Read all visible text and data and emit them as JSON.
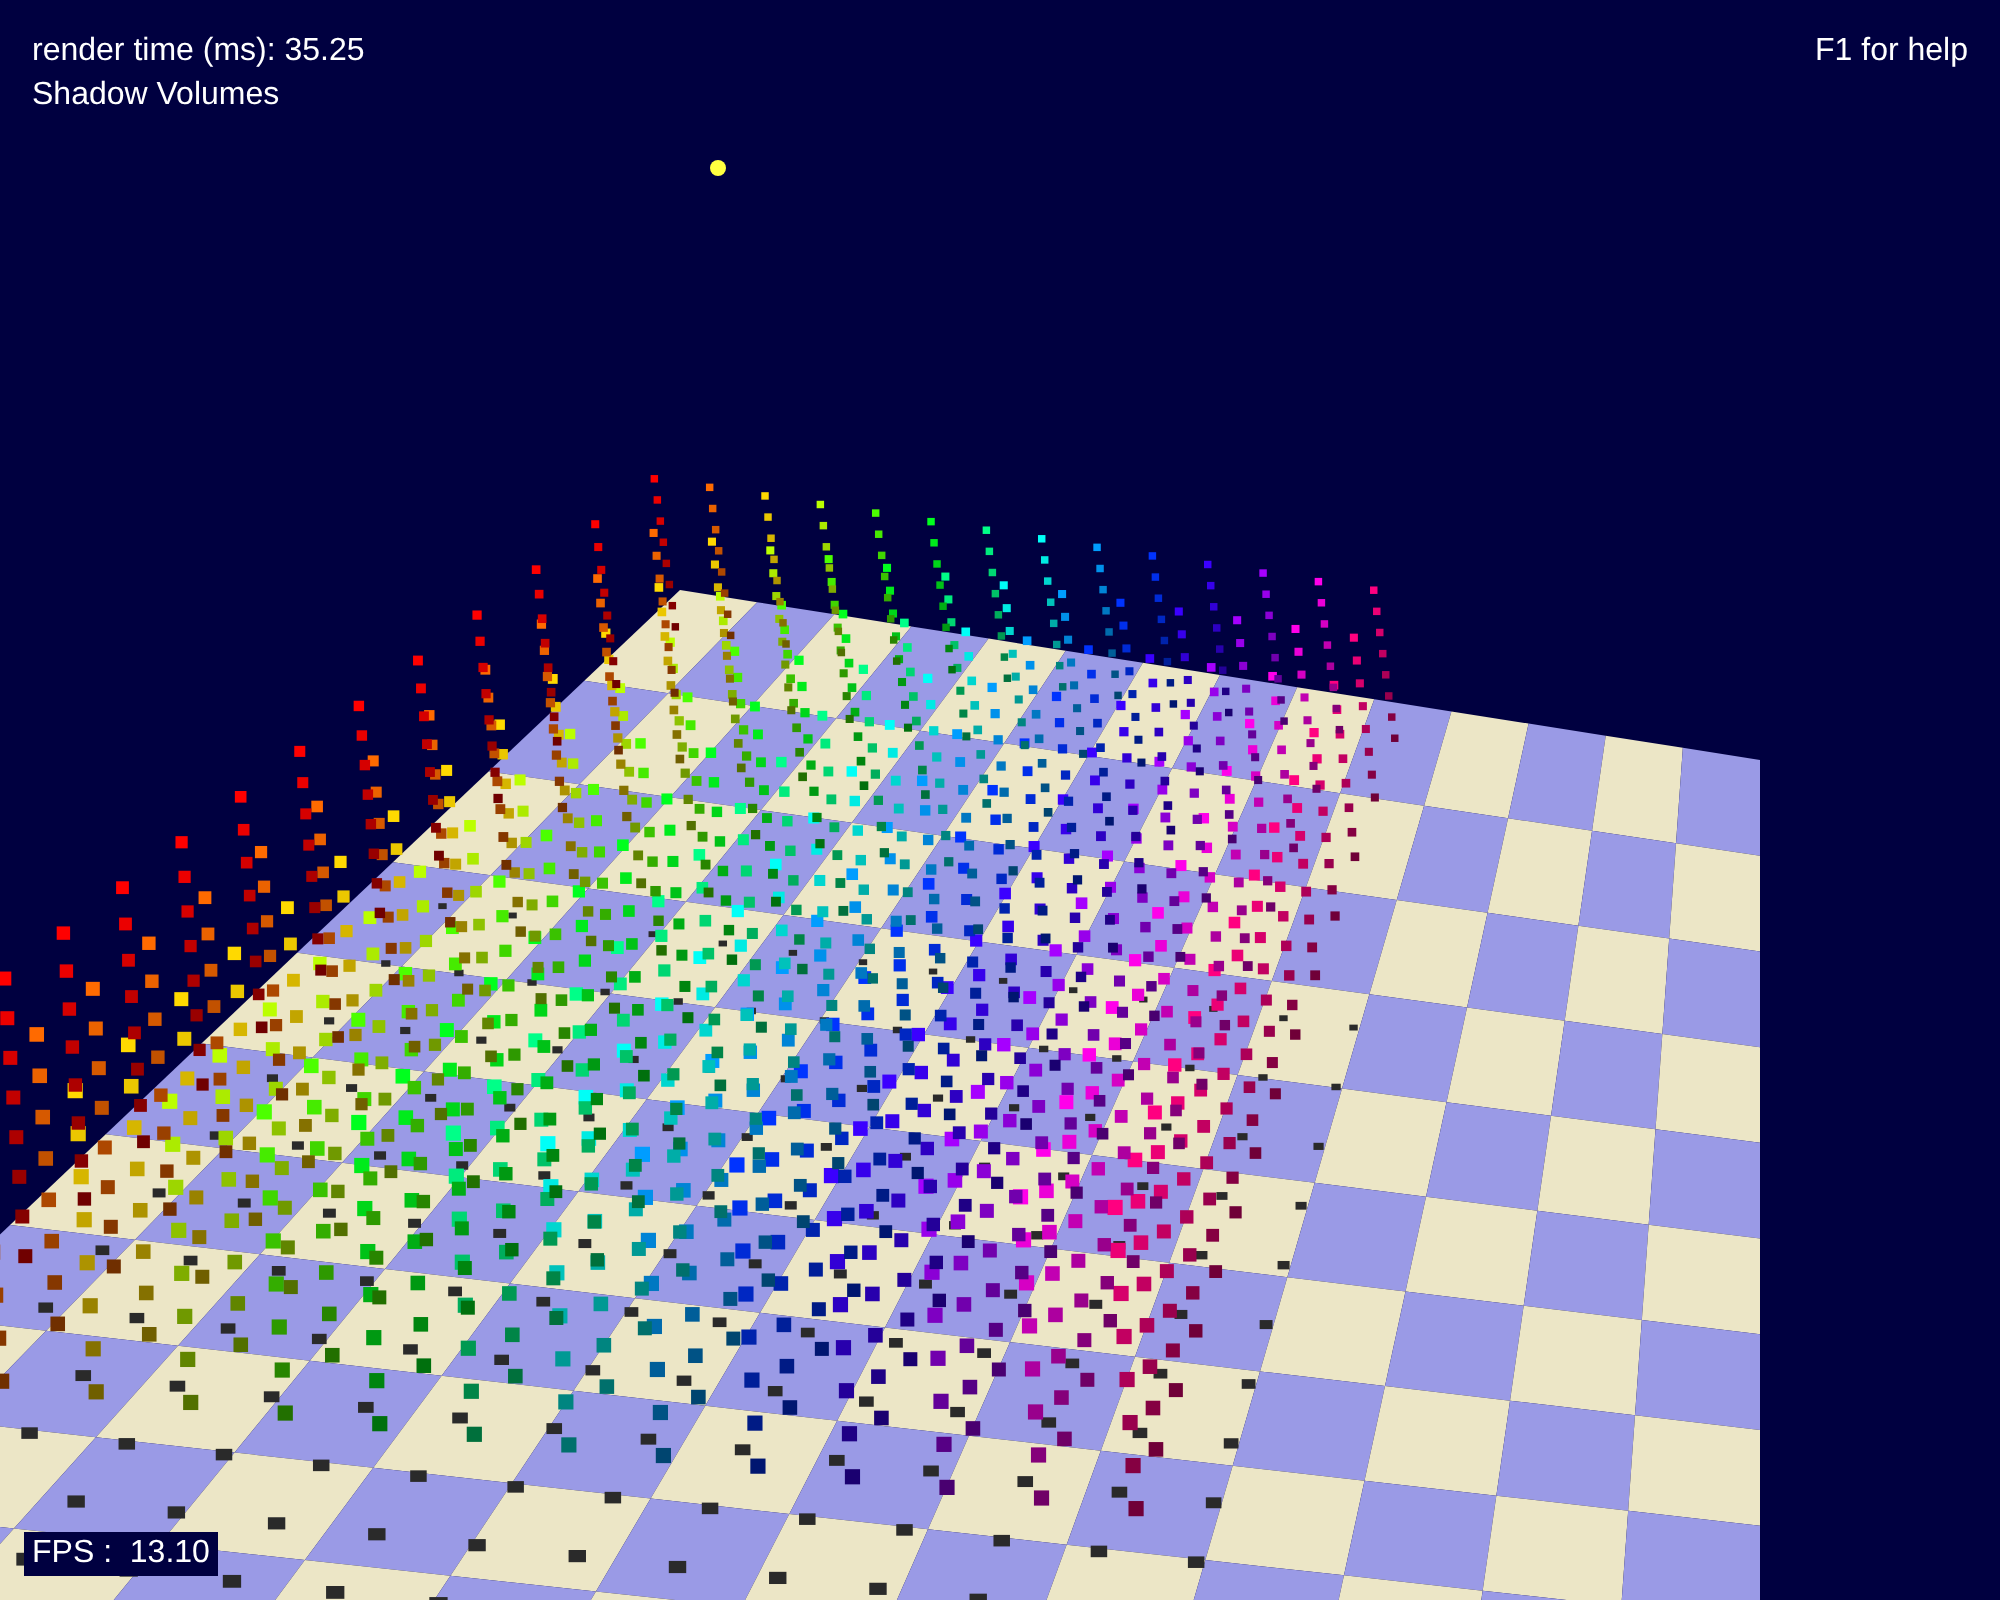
{
  "overlay": {
    "render_time": "render time (ms): 35.25",
    "mode": "Shadow Volumes",
    "help": "F1 for help",
    "fps": "FPS :  13.10"
  }
}
